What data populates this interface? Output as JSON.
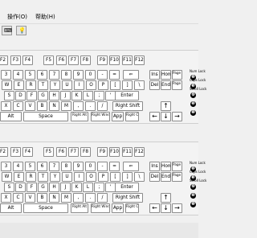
{
  "menu": {
    "operation": "操作(O)",
    "help": "帮助(H)"
  },
  "toolbar": {
    "items": [
      {
        "name": "keyboard-icon",
        "glyph": "⌨"
      },
      {
        "name": "help-bulb-icon",
        "glyph": "💡"
      }
    ]
  },
  "keyboard": {
    "fn_row": [
      "F2",
      "F3",
      "F4",
      "F5",
      "F6",
      "F7",
      "F8",
      "F9",
      "F10",
      "F11",
      "F12"
    ],
    "num_row": [
      "3",
      "4",
      "5",
      "6",
      "7",
      "8",
      "9",
      "0",
      "-",
      "=",
      "⇐"
    ],
    "q_row": [
      "W",
      "E",
      "R",
      "T",
      "Y",
      "U",
      "I",
      "O",
      "P",
      "[",
      "]",
      "\\"
    ],
    "a_row": [
      "S",
      "D",
      "F",
      "G",
      "H",
      "J",
      "K",
      "L",
      ";",
      "'",
      "Enter"
    ],
    "z_row": [
      "X",
      "C",
      "V",
      "B",
      "N",
      "M",
      ",",
      ".",
      "/",
      "Right Shift"
    ],
    "bottom_row": [
      "Alt",
      "Space",
      "Right Alt",
      "Right Windows",
      "App",
      "Right Ctrl"
    ],
    "nav_row1": [
      "Ins",
      "Home",
      "Page Up"
    ],
    "nav_row2": [
      "Del",
      "End",
      "Page Down"
    ],
    "arrows": {
      "up": "↑",
      "left": "←",
      "down": "↓",
      "right": "→"
    },
    "indicators": {
      "num": "Num Lock",
      "caps": "Caps Lock",
      "scroll": "Scroll Lock",
      "badges": [
        "❷",
        "❸",
        "❹",
        "❺",
        "❶"
      ]
    }
  }
}
